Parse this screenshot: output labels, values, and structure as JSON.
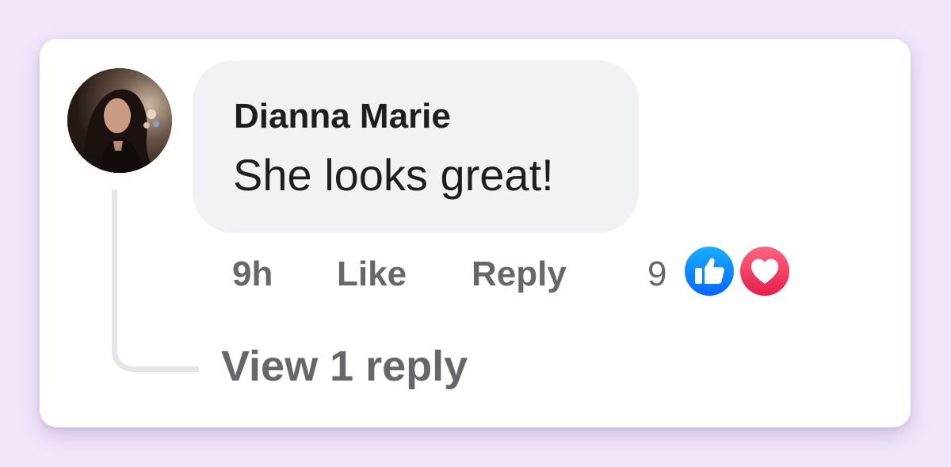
{
  "comment": {
    "author": "Dianna Marie",
    "text": "She looks great!",
    "timestamp": "9h",
    "like_label": "Like",
    "reply_label": "Reply",
    "reaction_count": "9",
    "reactions": [
      "like-icon",
      "love-icon"
    ],
    "view_replies_label": "View 1 reply"
  },
  "colors": {
    "page_background": "#f2e6fb",
    "card_background": "#ffffff",
    "bubble_background": "#f0f2f5",
    "text_primary": "#1c1e21",
    "text_secondary": "#65676b",
    "like_blue": "#0866ff",
    "love_red": "#f33e58"
  }
}
